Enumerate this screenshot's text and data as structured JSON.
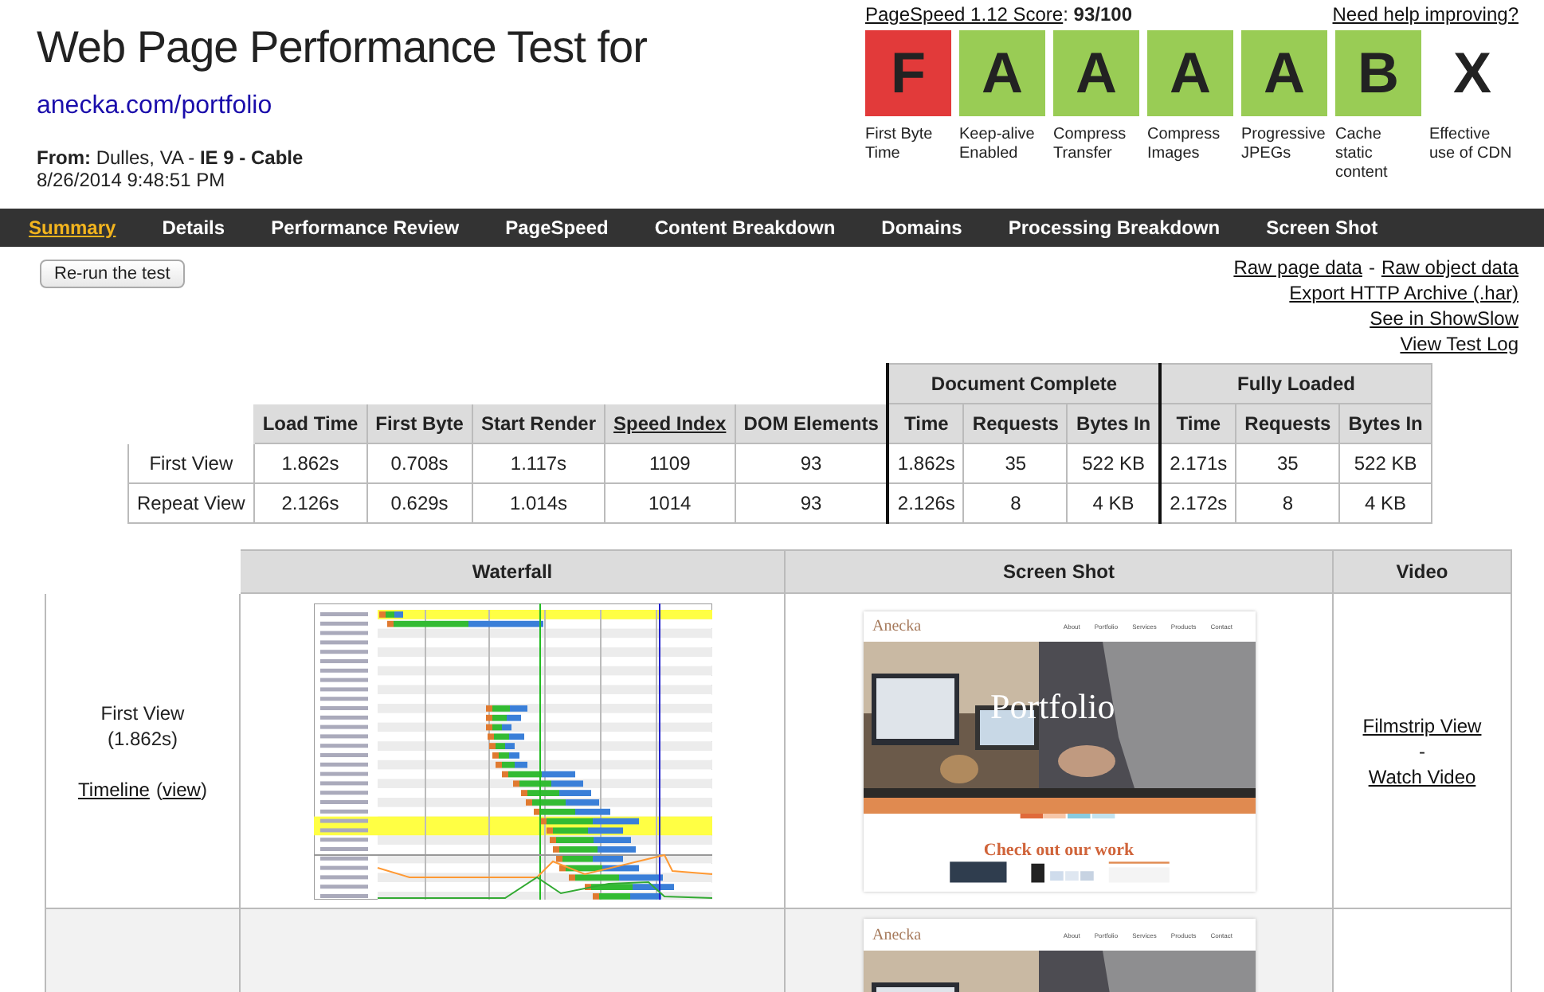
{
  "title": "Web Page Performance Test for",
  "url": "anecka.com/portfolio",
  "from_line": "**From:** Dulles, VA - **IE 9 - Cable**",
  "date": "8/26/2014 9:48:51 PM",
  "pagespeed": {
    "link": "PageSpeed 1.12 Score",
    "separator": ":",
    "score": "93/100"
  },
  "help_link": "Need help improving?",
  "grades": [
    {
      "grade": "F",
      "label": "First Byte Time",
      "color": "#e23a3a"
    },
    {
      "grade": "A",
      "label": "Keep-alive Enabled",
      "color": "#99cc55"
    },
    {
      "grade": "A",
      "label": "Compress Transfer",
      "color": "#99cc55"
    },
    {
      "grade": "A",
      "label": "Compress Images",
      "color": "#99cc55"
    },
    {
      "grade": "A",
      "label": "Progressive JPEGs",
      "color": "#99cc55"
    },
    {
      "grade": "B",
      "label": "Cache static content",
      "color": "#99cc55"
    },
    {
      "grade": "X",
      "label": "Effective use of CDN"
    }
  ],
  "tabs": [
    {
      "label": "Summary",
      "selected": true
    },
    {
      "label": "Details",
      "selected": false
    },
    {
      "label": "Performance Review",
      "selected": false
    },
    {
      "label": "PageSpeed",
      "selected": false
    },
    {
      "label": "Content Breakdown",
      "selected": false
    },
    {
      "label": "Domains",
      "selected": false
    },
    {
      "label": "Processing Breakdown",
      "selected": false
    },
    {
      "label": "Screen Shot",
      "selected": false
    }
  ],
  "rerun_button": "Re-run the test",
  "raw_links": {
    "first": "Raw page data",
    "separator": "-",
    "second": "Raw object data"
  },
  "links": [
    "Export HTTP Archive (.har)",
    "See in ShowSlow",
    "View Test Log"
  ],
  "results": {
    "groups": [
      "Document Complete",
      "Fully Loaded"
    ],
    "columns": [
      {
        "label": "Load Time",
        "link": false
      },
      {
        "label": "First Byte",
        "link": false
      },
      {
        "label": "Start Render",
        "link": false
      },
      {
        "label": "Speed Index",
        "link": true
      },
      {
        "label": "DOM Elements",
        "link": false
      },
      {
        "label": "Time",
        "link": false
      },
      {
        "label": "Requests",
        "link": false
      },
      {
        "label": "Bytes In",
        "link": false
      },
      {
        "label": "Time",
        "link": false
      },
      {
        "label": "Requests",
        "link": false
      },
      {
        "label": "Bytes In",
        "link": false
      }
    ],
    "rows": [
      {
        "label": "First View",
        "cells": [
          "1.862s",
          "0.708s",
          "1.117s",
          "1109",
          "93",
          "1.862s",
          "35",
          "522 KB",
          "2.171s",
          "35",
          "522 KB"
        ]
      },
      {
        "label": "Repeat View",
        "cells": [
          "2.126s",
          "0.629s",
          "1.014s",
          "1014",
          "93",
          "2.126s",
          "8",
          "4 KB",
          "2.172s",
          "8",
          "4 KB"
        ]
      }
    ]
  },
  "media": {
    "headers": [
      "Waterfall",
      "Screen Shot",
      "Video"
    ],
    "first_view": {
      "label": "First View",
      "time": "(1.862s)",
      "timeline": "Timeline",
      "open_paren": "(",
      "view": "view",
      "close_paren": ")",
      "filmstrip": "Filmstrip View",
      "separator": "-",
      "watch": "Watch Video"
    },
    "screenshots": [
      {
        "brand": "Anecka",
        "nav": [
          "About",
          "Portfolio",
          "Services",
          "Products",
          "Contact"
        ],
        "hero": "Portfolio",
        "cta": "Check out our work"
      },
      {
        "brand": "Anecka",
        "nav": [
          "About",
          "Portfolio",
          "Services",
          "Products",
          "Contact"
        ]
      }
    ]
  }
}
